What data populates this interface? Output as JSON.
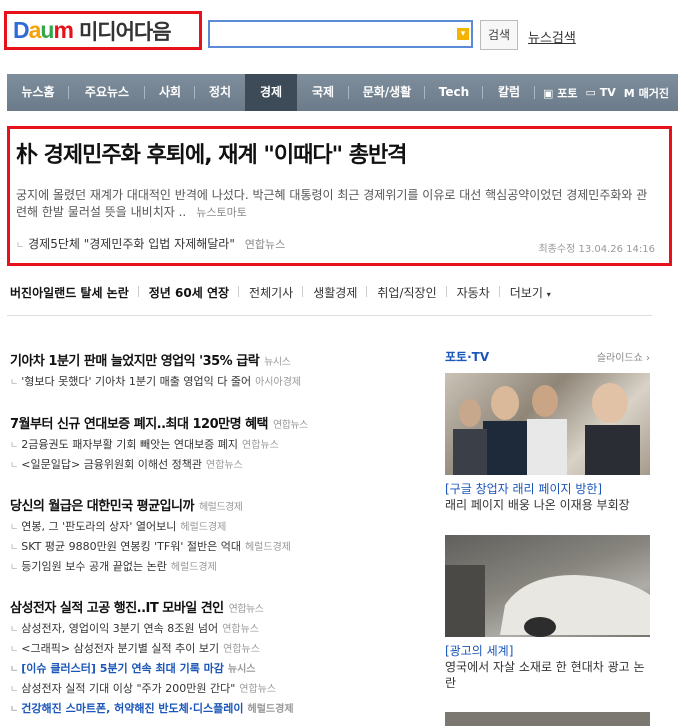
{
  "header": {
    "logo_daum": [
      "D",
      "a",
      "u",
      "m"
    ],
    "logo_media": "미디어다음",
    "search_placeholder": "",
    "search_button": "검색",
    "news_search": "뉴스검색"
  },
  "gnb": {
    "items": [
      "뉴스홈",
      "주요뉴스",
      "사회",
      "정치",
      "경제",
      "국제",
      "문화/생활",
      "Tech",
      "칼럼"
    ],
    "active": "경제",
    "extras": [
      "포토",
      "TV",
      "매거진"
    ]
  },
  "headline": {
    "title": "朴 경제민주화 후퇴에, 재계 \"이때다\" 총반격",
    "body": "궁지에 몰렸던 재계가 대대적인 반격에 나섰다. 박근혜 대통령이 최근 경제위기를 이유로 대선 핵심공약이었던 경제민주화와 관련해 한발 물러설 뜻을 내비치자 ..",
    "source": "뉴스토마토",
    "related_title": "경제5단체 \"경제민주화 입법 자제해달라\"",
    "related_source": "연합뉴스",
    "updated": "최종수정 13.04.26 14:16"
  },
  "subnav": {
    "items": [
      "버진아일랜드 탈세 논란",
      "정년 60세 연장",
      "전체기사",
      "생활경제",
      "취업/직장인",
      "자동차",
      "더보기"
    ]
  },
  "news": [
    {
      "title": "기아차 1분기 판매 늘었지만 영업익 '35% 급락",
      "source": "뉴시스",
      "subs": [
        {
          "text": "'형보다 못했다' 기아차 1분기 매출 영업익 다 줄어",
          "source": "아시아경제"
        }
      ]
    },
    {
      "title": "7월부터 신규 연대보증 폐지..최대 120만명 혜택",
      "source": "연합뉴스",
      "subs": [
        {
          "text": "2금융권도 패자부활 기회 빼앗는 연대보증 폐지",
          "source": "연합뉴스"
        },
        {
          "text": "<일문일답> 금융위원회 이해선 정책관",
          "source": "연합뉴스"
        }
      ]
    },
    {
      "title": "당신의 월급은 대한민국 평균입니까",
      "source": "헤럴드경제",
      "subs": [
        {
          "text": "연봉, 그 '판도라의 상자' 열어보니",
          "source": "헤럴드경제"
        },
        {
          "text": "SKT 평균 9880만원 연봉킹 'TF워' 절반은 억대",
          "source": "헤럴드경제"
        },
        {
          "text": "등기임원 보수 공개 끝없는 논란",
          "source": "헤럴드경제"
        }
      ]
    },
    {
      "title": "삼성전자 실적 고공 행진..IT 모바일 견인",
      "source": "연합뉴스",
      "subs": [
        {
          "text": "삼성전자, 영업이익 3분기 연속 8조원 넘어",
          "source": "연합뉴스"
        },
        {
          "text": "<그래픽> 삼성전자 분기별 실적 추이 보기",
          "source": "연합뉴스"
        },
        {
          "text": "[이슈 클러스터] 5분기 연속 최대 기록 마감",
          "source": "뉴시스",
          "highlight": true
        },
        {
          "text": "삼성전자 실적 기대 이상 \"주가 200만원 간다\"",
          "source": "연합뉴스"
        },
        {
          "text": "건강해진 스마트폰, 허약해진 반도체·디스플레이",
          "source": "헤럴드경제",
          "highlight": true
        }
      ]
    }
  ],
  "photo_tv": {
    "label": "포토·TV",
    "slide_label": "슬라이드쇼",
    "items": [
      {
        "caption_title": "[구글 창업자 래리 페이지 방한]",
        "caption_text": "래리 페이지 배웅 나온 이재용 부회장"
      },
      {
        "caption_title": "[광고의 세계]",
        "caption_text": "영국에서 자살 소재로 한 현대차 광고 논란"
      }
    ]
  }
}
